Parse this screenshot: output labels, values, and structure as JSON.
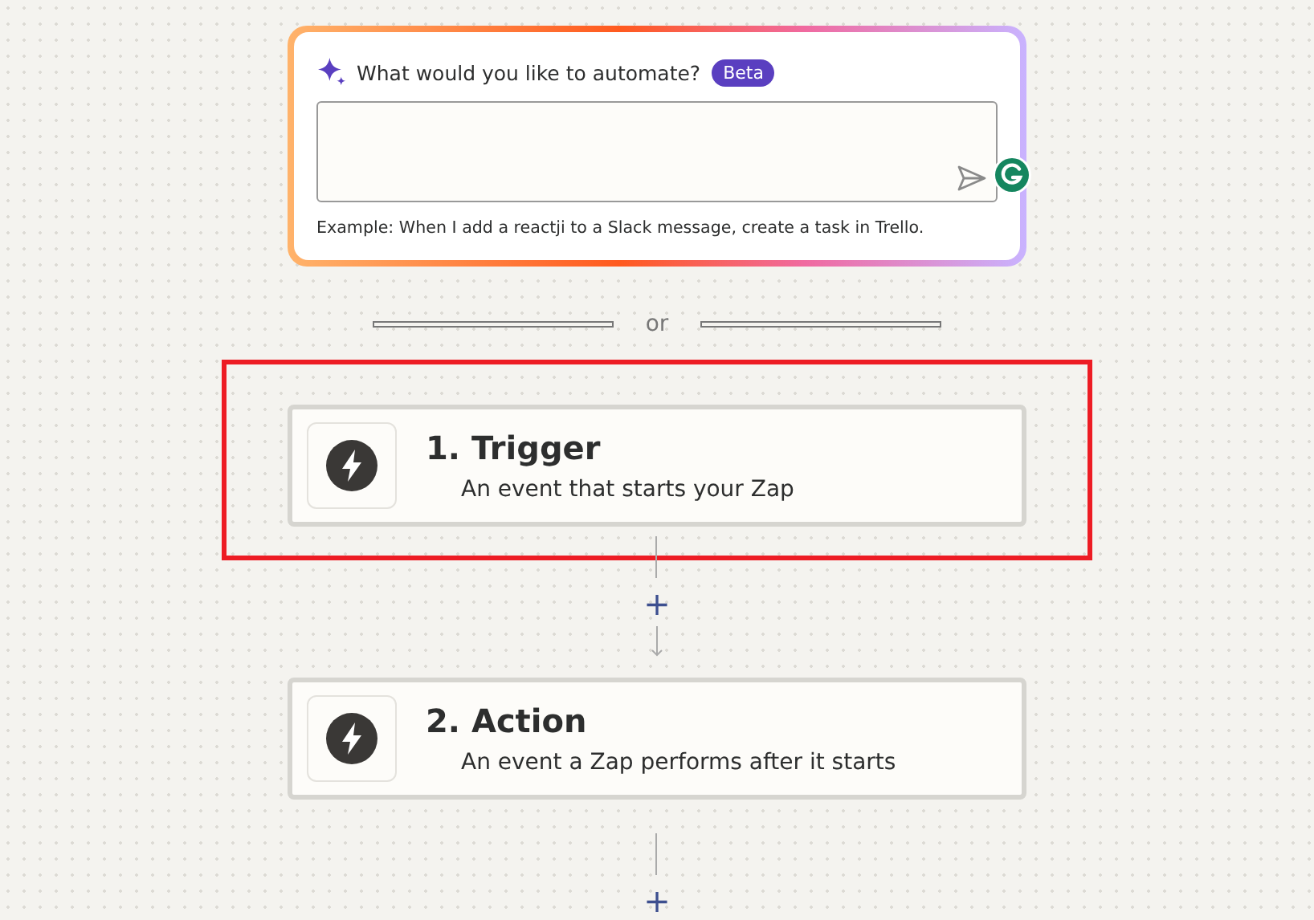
{
  "prompt": {
    "title": "What would you like to automate?",
    "badge": "Beta",
    "example": "Example: When I add a reactji to a Slack message, create a task in Trello."
  },
  "divider": {
    "label": "or"
  },
  "steps": [
    {
      "title": "1. Trigger",
      "subtitle": "An event that starts your Zap",
      "highlighted": true
    },
    {
      "title": "2. Action",
      "subtitle": "An event a Zap performs after it starts",
      "highlighted": false
    }
  ],
  "add_step_symbol": "+"
}
